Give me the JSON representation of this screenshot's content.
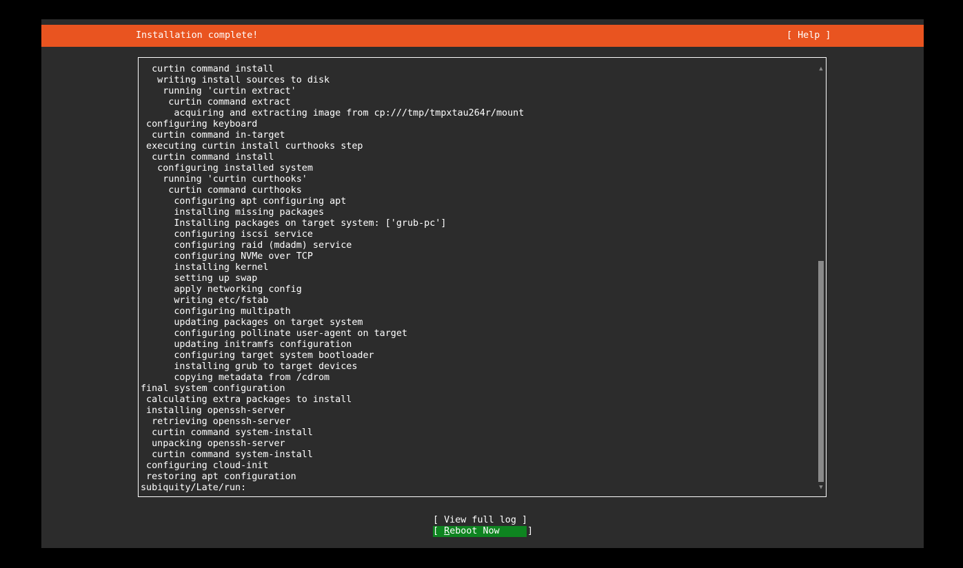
{
  "header": {
    "title": "Installation complete!",
    "help_label": "[ Help ]"
  },
  "log": {
    "lines": [
      "  curtin command install",
      "   writing install sources to disk",
      "    running 'curtin extract'",
      "     curtin command extract",
      "      acquiring and extracting image from cp:///tmp/tmpxtau264r/mount",
      " configuring keyboard",
      "  curtin command in-target",
      " executing curtin install curthooks step",
      "  curtin command install",
      "   configuring installed system",
      "    running 'curtin curthooks'",
      "     curtin command curthooks",
      "      configuring apt configuring apt",
      "      installing missing packages",
      "      Installing packages on target system: ['grub-pc']",
      "      configuring iscsi service",
      "      configuring raid (mdadm) service",
      "      configuring NVMe over TCP",
      "      installing kernel",
      "      setting up swap",
      "      apply networking config",
      "      writing etc/fstab",
      "      configuring multipath",
      "      updating packages on target system",
      "      configuring pollinate user-agent on target",
      "      updating initramfs configuration",
      "      configuring target system bootloader",
      "      installing grub to target devices",
      "      copying metadata from /cdrom",
      "final system configuration",
      " calculating extra packages to install",
      " installing openssh-server",
      "  retrieving openssh-server",
      "  curtin command system-install",
      "  unpacking openssh-server",
      "  curtin command system-install",
      " configuring cloud-init",
      " restoring apt configuration",
      "subiquity/Late/run:"
    ],
    "scroll_up_glyph": "▲",
    "scroll_down_glyph": "▼",
    "scroll_position": 0.92
  },
  "buttons": {
    "view_log": "[ View full log ]",
    "reboot_open": "[ ",
    "reboot_hotkey": "R",
    "reboot_rest": "eboot Now     ]"
  },
  "colors": {
    "header": "#e95420",
    "background": "#2c2c2c",
    "focused_button": "#0e8420"
  }
}
